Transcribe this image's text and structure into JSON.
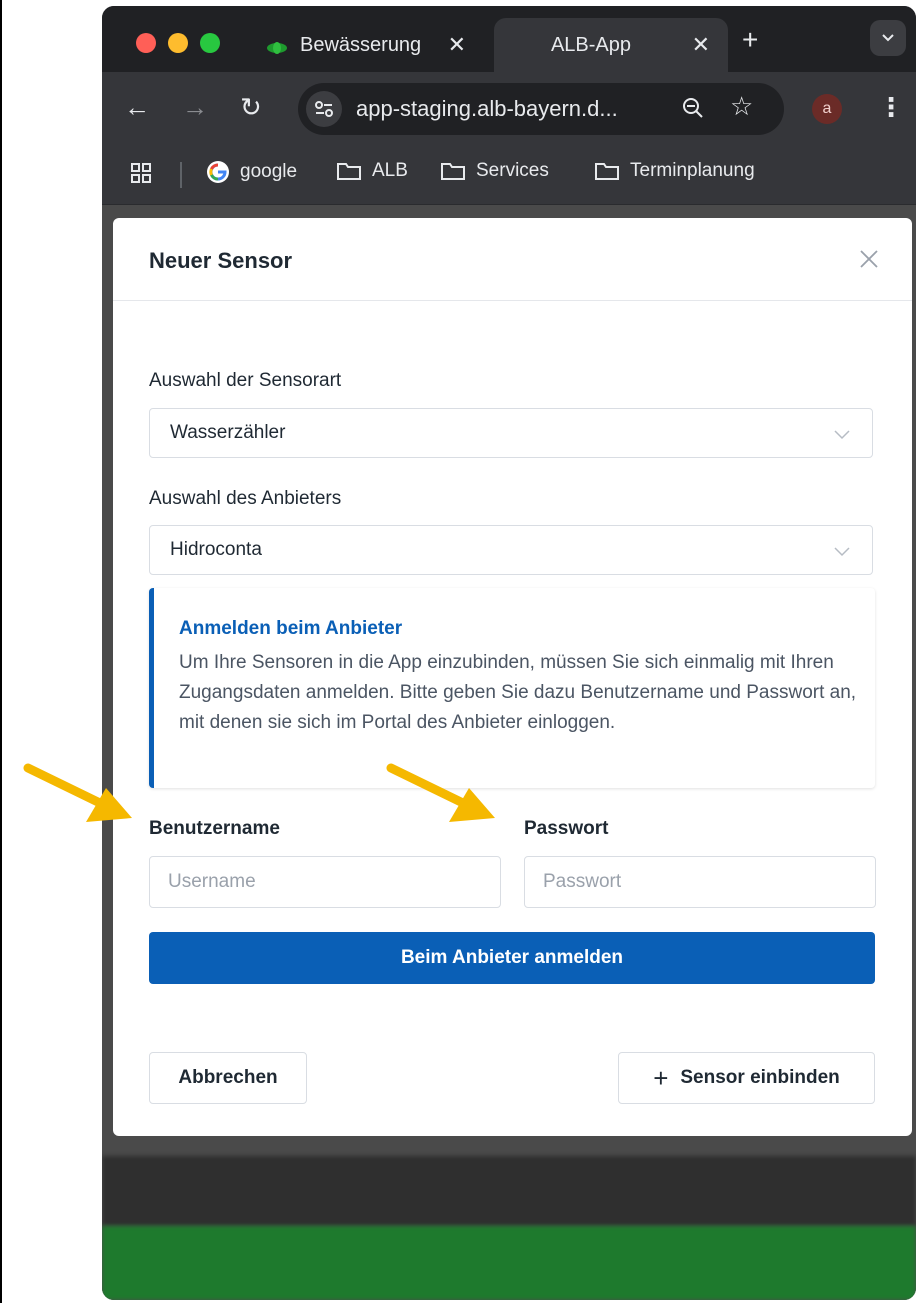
{
  "browser": {
    "tabs": [
      {
        "title": "Bewässerung",
        "active": false
      },
      {
        "title": "ALB-App",
        "active": true
      }
    ],
    "url": "app-staging.alb-bayern.d...",
    "profile_initial": "a",
    "bookmarks": [
      {
        "label": "google",
        "icon": "google-icon"
      },
      {
        "label": "ALB",
        "icon": "folder-icon"
      },
      {
        "label": "Services",
        "icon": "folder-icon"
      },
      {
        "label": "Terminplanung",
        "icon": "folder-icon"
      }
    ]
  },
  "modal": {
    "title": "Neuer Sensor",
    "sensor_type": {
      "label": "Auswahl der Sensorart",
      "value": "Wasserzähler"
    },
    "provider": {
      "label": "Auswahl des Anbieters",
      "value": "Hidroconta"
    },
    "info": {
      "title": "Anmelden beim Anbieter",
      "text": "Um Ihre Sensoren in die App einzubinden, müssen Sie sich einmalig mit Ihren Zugangsdaten anmelden. Bitte geben Sie dazu Benutzername und Passwort an, mit denen sie sich im Portal des Anbieter einloggen."
    },
    "username": {
      "label": "Benutzername",
      "placeholder": "Username"
    },
    "password": {
      "label": "Passwort",
      "placeholder": "Passwort"
    },
    "login_button": "Beim Anbieter anmelden",
    "cancel_button": "Abbrechen",
    "add_button": "Sensor einbinden"
  },
  "colors": {
    "primary": "#0a5fb6",
    "annotation_arrow": "#f5b800"
  }
}
